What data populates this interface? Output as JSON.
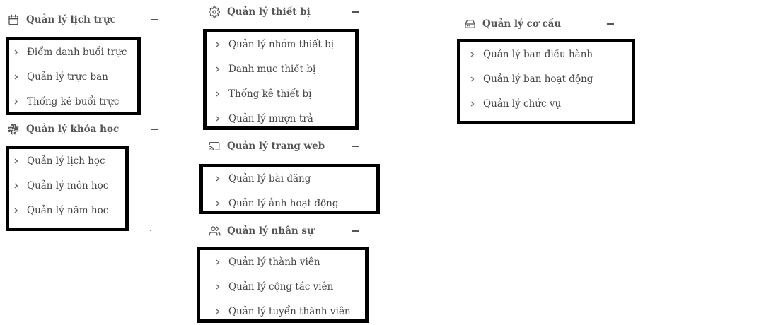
{
  "sections": {
    "lich_truc": {
      "title": "Quản lý lịch trực",
      "icon": "calendar-icon",
      "items": [
        "Điểm danh buổi trực",
        "Quản lý trực ban",
        "Thống kê buổi trực"
      ]
    },
    "khoa_hoc": {
      "title": "Quản lý khóa học",
      "icon": "slack-icon",
      "items": [
        "Quản lý lịch học",
        "Quản lý môn học",
        "Quản lý năm học"
      ]
    },
    "thiet_bi": {
      "title": "Quản lý thiết bị",
      "icon": "gear-icon",
      "items": [
        "Quản lý nhóm thiết bị",
        "Danh mục thiết bị",
        "Thống kê thiết bị",
        "Quản lý mượn-trả"
      ]
    },
    "trang_web": {
      "title": "Quản lý trang web",
      "icon": "cast-icon",
      "items": [
        "Quản lý bài đăng",
        "Quản lý ảnh hoạt động"
      ]
    },
    "nhan_su": {
      "title": "Quản lý nhân sự",
      "icon": "users-icon",
      "items": [
        "Quản lý thành viên",
        "Quản lý cộng tác viên",
        "Quản lý tuyển thành viên"
      ]
    },
    "co_cau": {
      "title": "Quản lý cơ cấu",
      "icon": "hard-drive-icon",
      "items": [
        "Quản lý ban điều hành",
        "Quản lý ban hoạt động",
        "Quản lý chức vụ"
      ]
    }
  },
  "colors": {
    "text": "#444444",
    "box_border": "#000000",
    "background": "#ffffff"
  }
}
